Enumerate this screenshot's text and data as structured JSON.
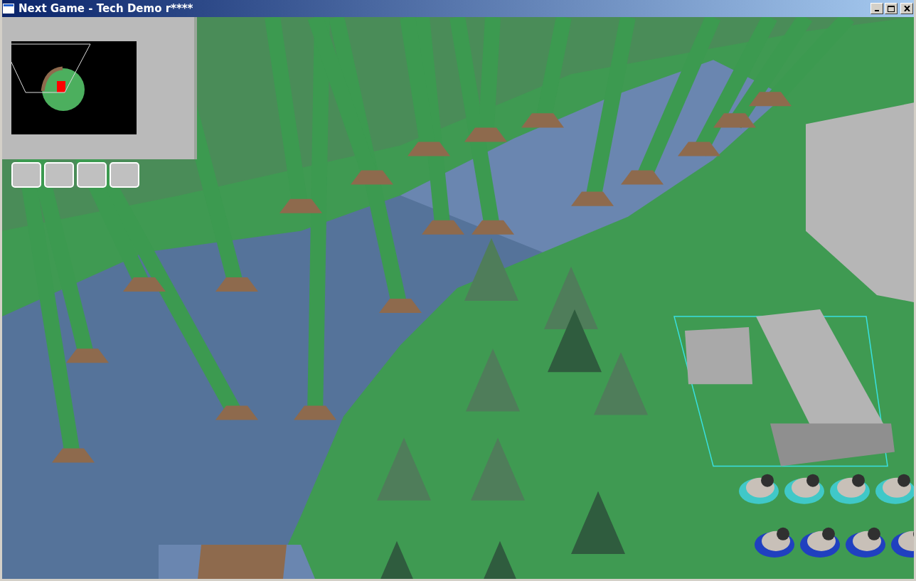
{
  "window": {
    "title": "Next Game - Tech Demo r****"
  }
}
